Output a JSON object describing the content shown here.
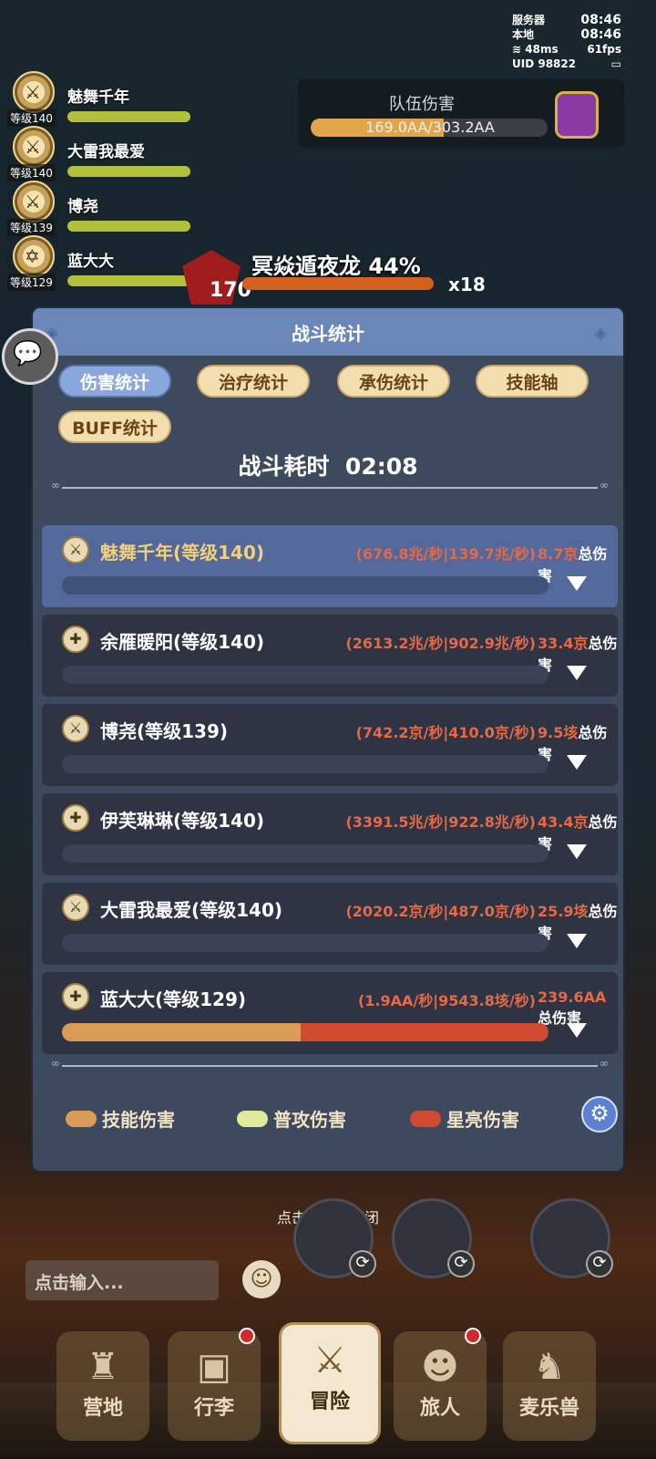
{
  "status": {
    "server_label": "服务器",
    "server_time": "08:46",
    "local_label": "本地",
    "local_time": "08:46",
    "ping": "48ms",
    "fps": "61fps",
    "uid_label": "UID",
    "uid": "98822"
  },
  "party": [
    {
      "name": "魅舞千年",
      "level": "等级140"
    },
    {
      "name": "大雷我最爱",
      "level": "等级140"
    },
    {
      "name": "博尧",
      "level": "等级139"
    },
    {
      "name": "蓝大大",
      "level": "等级129"
    }
  ],
  "team_damage": {
    "title": "队伍伤害",
    "value": "169.0AA/303.2AA"
  },
  "boss": {
    "name": "冥焱遁夜龙",
    "percent": "44%",
    "level": "170",
    "multiplier": "x18"
  },
  "modal": {
    "title": "战斗统计",
    "tabs": [
      {
        "label": "伤害统计",
        "active": true
      },
      {
        "label": "治疗统计",
        "active": false
      },
      {
        "label": "承伤统计",
        "active": false
      },
      {
        "label": "技能轴",
        "active": false
      },
      {
        "label": "BUFF统计",
        "active": false
      }
    ],
    "timer_label": "战斗耗时",
    "timer_value": "02:08",
    "total_label": "总伤害",
    "rows": [
      {
        "name": "魅舞千年(等级140)",
        "stats": "(676.8兆/秒|139.7兆/秒)",
        "total": "8.7京",
        "highlight": true,
        "skill": 0,
        "normal": 0,
        "star": 0
      },
      {
        "name": "余雁暖阳(等级140)",
        "stats": "(2613.2兆/秒|902.9兆/秒)",
        "total": "33.4京",
        "highlight": false,
        "skill": 0,
        "normal": 0,
        "star": 0
      },
      {
        "name": "博尧(等级139)",
        "stats": "(742.2京/秒|410.0京/秒)",
        "total": "9.5垓",
        "highlight": false,
        "skill": 0,
        "normal": 0,
        "star": 0
      },
      {
        "name": "伊芙琳琳(等级140)",
        "stats": "(3391.5兆/秒|922.8兆/秒)",
        "total": "43.4京",
        "highlight": false,
        "skill": 0,
        "normal": 0,
        "star": 0
      },
      {
        "name": "大雷我最爱(等级140)",
        "stats": "(2020.2京/秒|487.0京/秒)",
        "total": "25.9垓",
        "highlight": false,
        "skill": 0,
        "normal": 0,
        "star": 0
      },
      {
        "name": "蓝大大(等级129)",
        "stats": "(1.9AA/秒|9543.8垓/秒)",
        "total": "239.6AA",
        "highlight": false,
        "skill": 0.49,
        "normal": 0,
        "star": 0.51
      }
    ],
    "legend": [
      {
        "label": "技能伤害",
        "color": "#d99b55"
      },
      {
        "label": "普攻伤害",
        "color": "#dfeb9a"
      },
      {
        "label": "星亮伤害",
        "color": "#cf4a2e"
      }
    ]
  },
  "close_hint": "点击空白处关闭",
  "chat_placeholder": "点击输入...",
  "nav": [
    {
      "label": "营地",
      "active": false,
      "badge": false
    },
    {
      "label": "行李",
      "active": false,
      "badge": true
    },
    {
      "label": "冒险",
      "active": true,
      "badge": false
    },
    {
      "label": "旅人",
      "active": false,
      "badge": true
    },
    {
      "label": "麦乐兽",
      "active": false,
      "badge": false
    }
  ]
}
